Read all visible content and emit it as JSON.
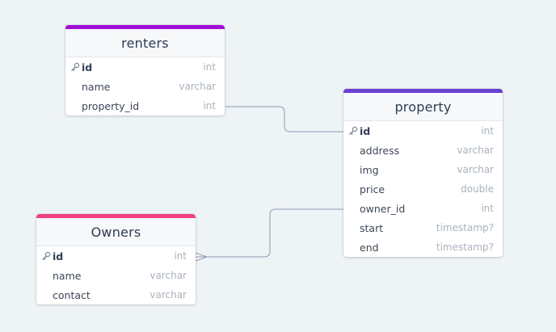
{
  "colors": {
    "renters": "#a10ed8",
    "property": "#6b3fcf",
    "owners": "#f0407e",
    "edge": "#8f9bb3"
  },
  "tables": {
    "renters": {
      "title": "renters",
      "fields": [
        {
          "name": "id",
          "type": "int",
          "pk": true
        },
        {
          "name": "name",
          "type": "varchar"
        },
        {
          "name": "property_id",
          "type": "int"
        }
      ]
    },
    "property": {
      "title": "property",
      "fields": [
        {
          "name": "id",
          "type": "int",
          "pk": true
        },
        {
          "name": "address",
          "type": "varchar"
        },
        {
          "name": "img",
          "type": "varchar"
        },
        {
          "name": "price",
          "type": "double"
        },
        {
          "name": "owner_id",
          "type": "int"
        },
        {
          "name": "start",
          "type": "timestamp?"
        },
        {
          "name": "end",
          "type": "timestamp?"
        }
      ]
    },
    "owners": {
      "title": "Owners",
      "fields": [
        {
          "name": "id",
          "type": "int",
          "pk": true
        },
        {
          "name": "name",
          "type": "varchar"
        },
        {
          "name": "contact",
          "type": "varchar"
        }
      ]
    }
  },
  "relations": [
    {
      "from": "renters.property_id",
      "to": "property.id"
    },
    {
      "from": "property.owner_id",
      "to": "Owners.id",
      "to_end": "many"
    }
  ]
}
